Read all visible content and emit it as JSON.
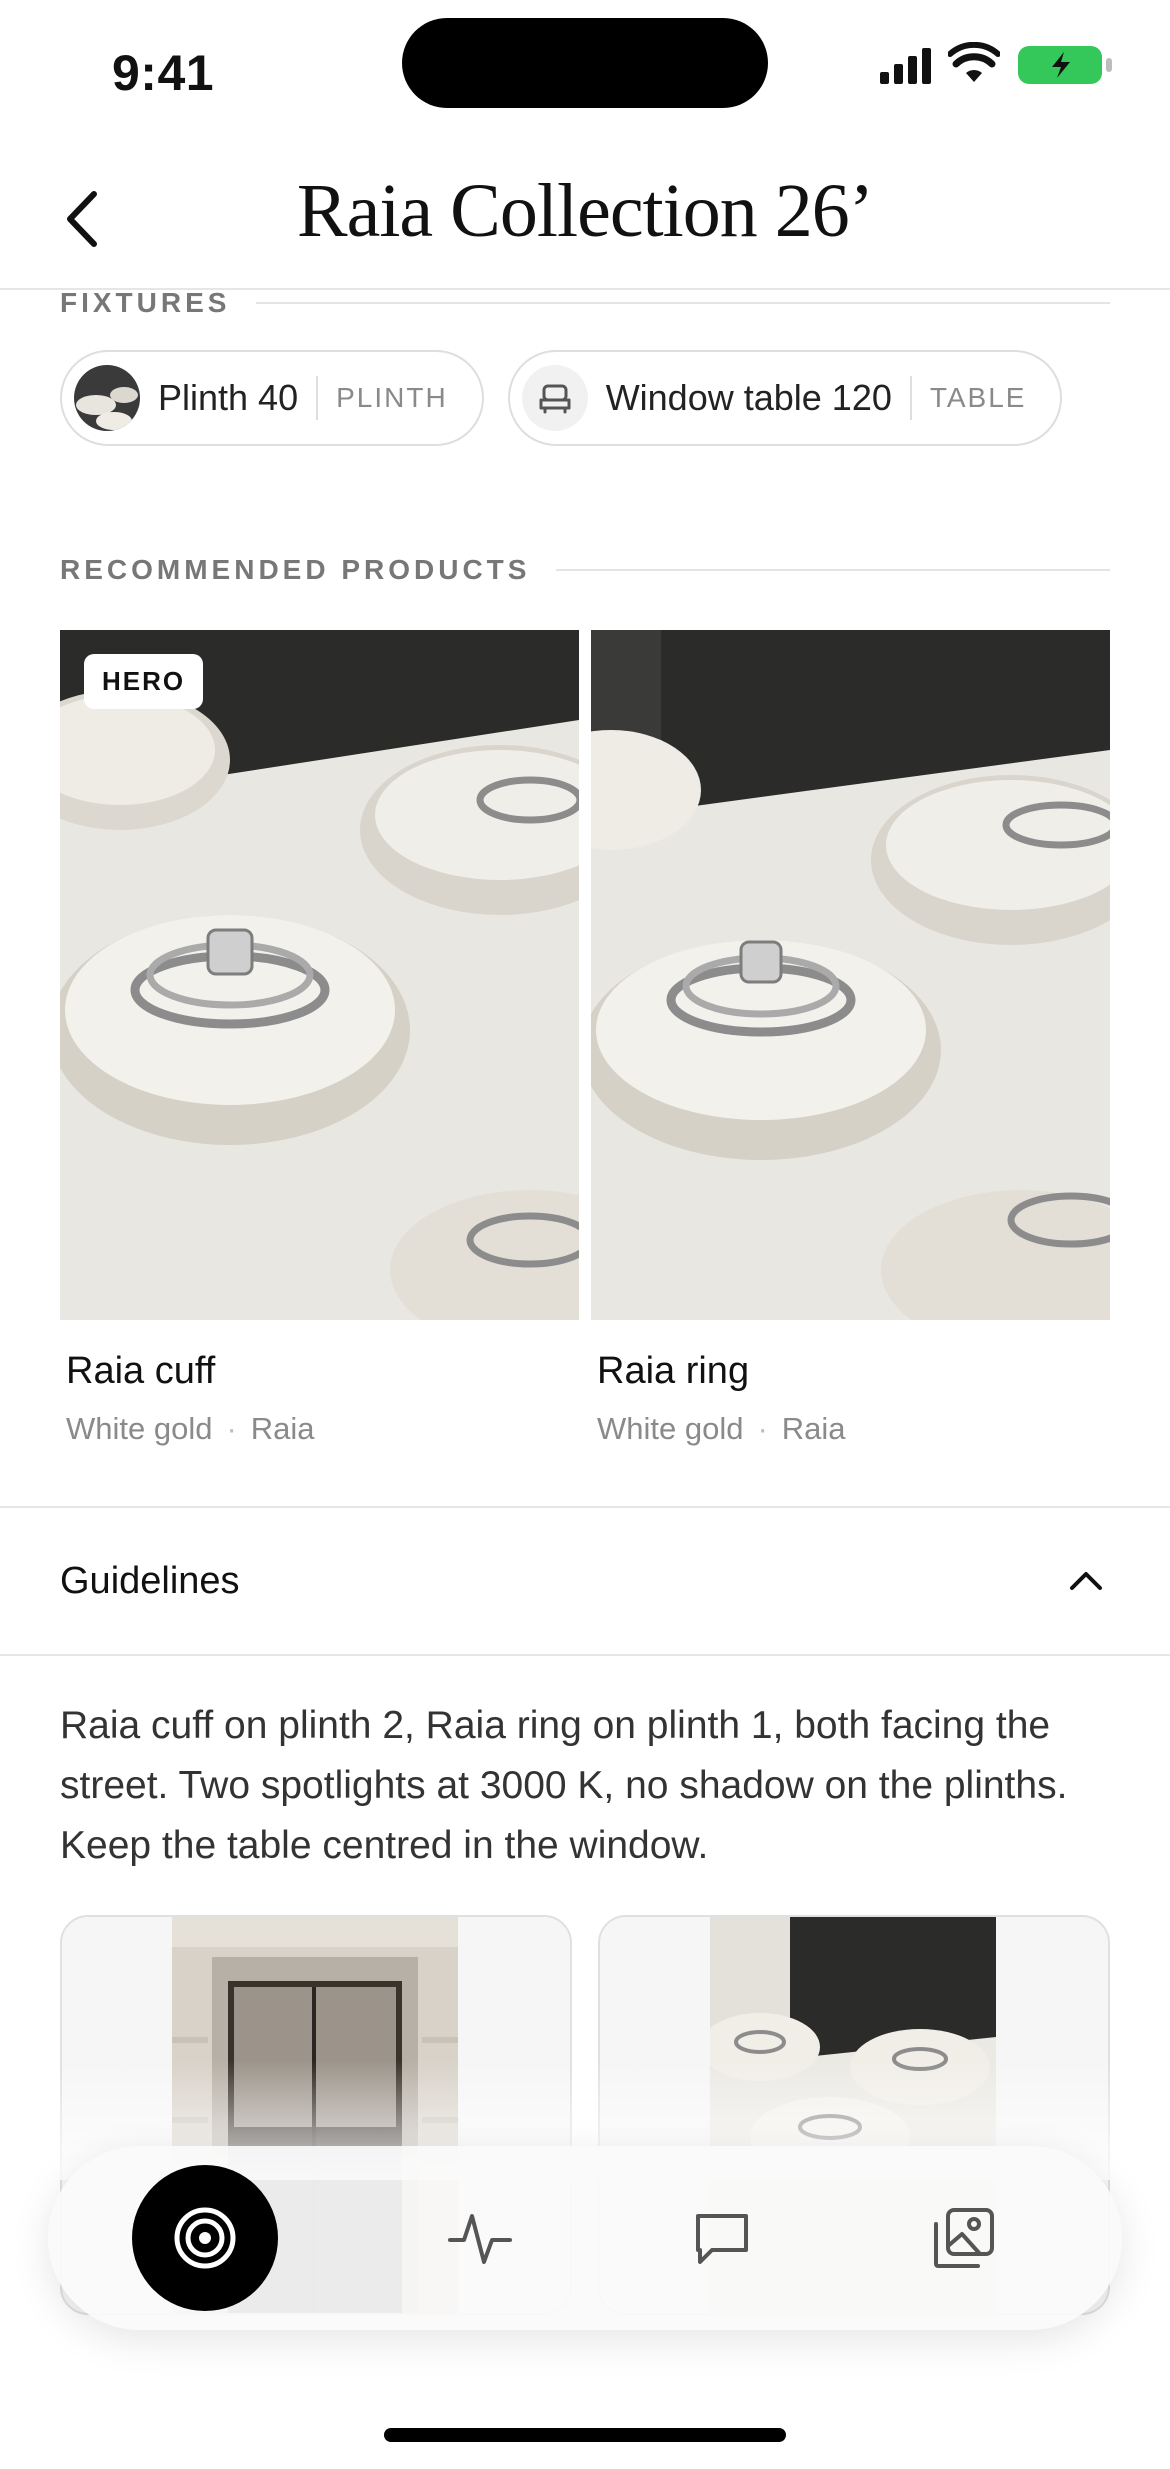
{
  "status_bar": {
    "time": "9:41"
  },
  "header": {
    "title": "Raia Collection 26’",
    "back_icon": "chevron-left-icon"
  },
  "fixtures": {
    "section_label": "FIXTURES",
    "items": [
      {
        "name": "Plinth 40",
        "type": "PLINTH",
        "icon": "plinth-thumbnail"
      },
      {
        "name": "Window table 120",
        "type": "TABLE",
        "icon": "table-icon"
      }
    ]
  },
  "recommended": {
    "section_label": "RECOMMENDED PRODUCTS",
    "products": [
      {
        "name": "Raia cuff",
        "material": "White gold",
        "collection": "Raia",
        "badge": "HERO"
      },
      {
        "name": "Raia ring",
        "material": "White gold",
        "collection": "Raia",
        "badge": ""
      }
    ],
    "separator": "·"
  },
  "guidelines": {
    "title": "Guidelines",
    "expanded": true,
    "text": "Raia cuff on plinth 2, Raia ring on plinth 1, both facing the street. Two spotlights at 3000 K, no shadow on the plinths. Keep the table centred in the window."
  },
  "tab_bar": {
    "items": [
      {
        "icon": "target-icon",
        "active": true
      },
      {
        "icon": "activity-icon",
        "active": false
      },
      {
        "icon": "chat-icon",
        "active": false
      },
      {
        "icon": "gallery-icon",
        "active": false
      }
    ]
  },
  "colors": {
    "accent": "#000000",
    "muted_text": "#8a8a8a",
    "battery": "#34c759"
  }
}
